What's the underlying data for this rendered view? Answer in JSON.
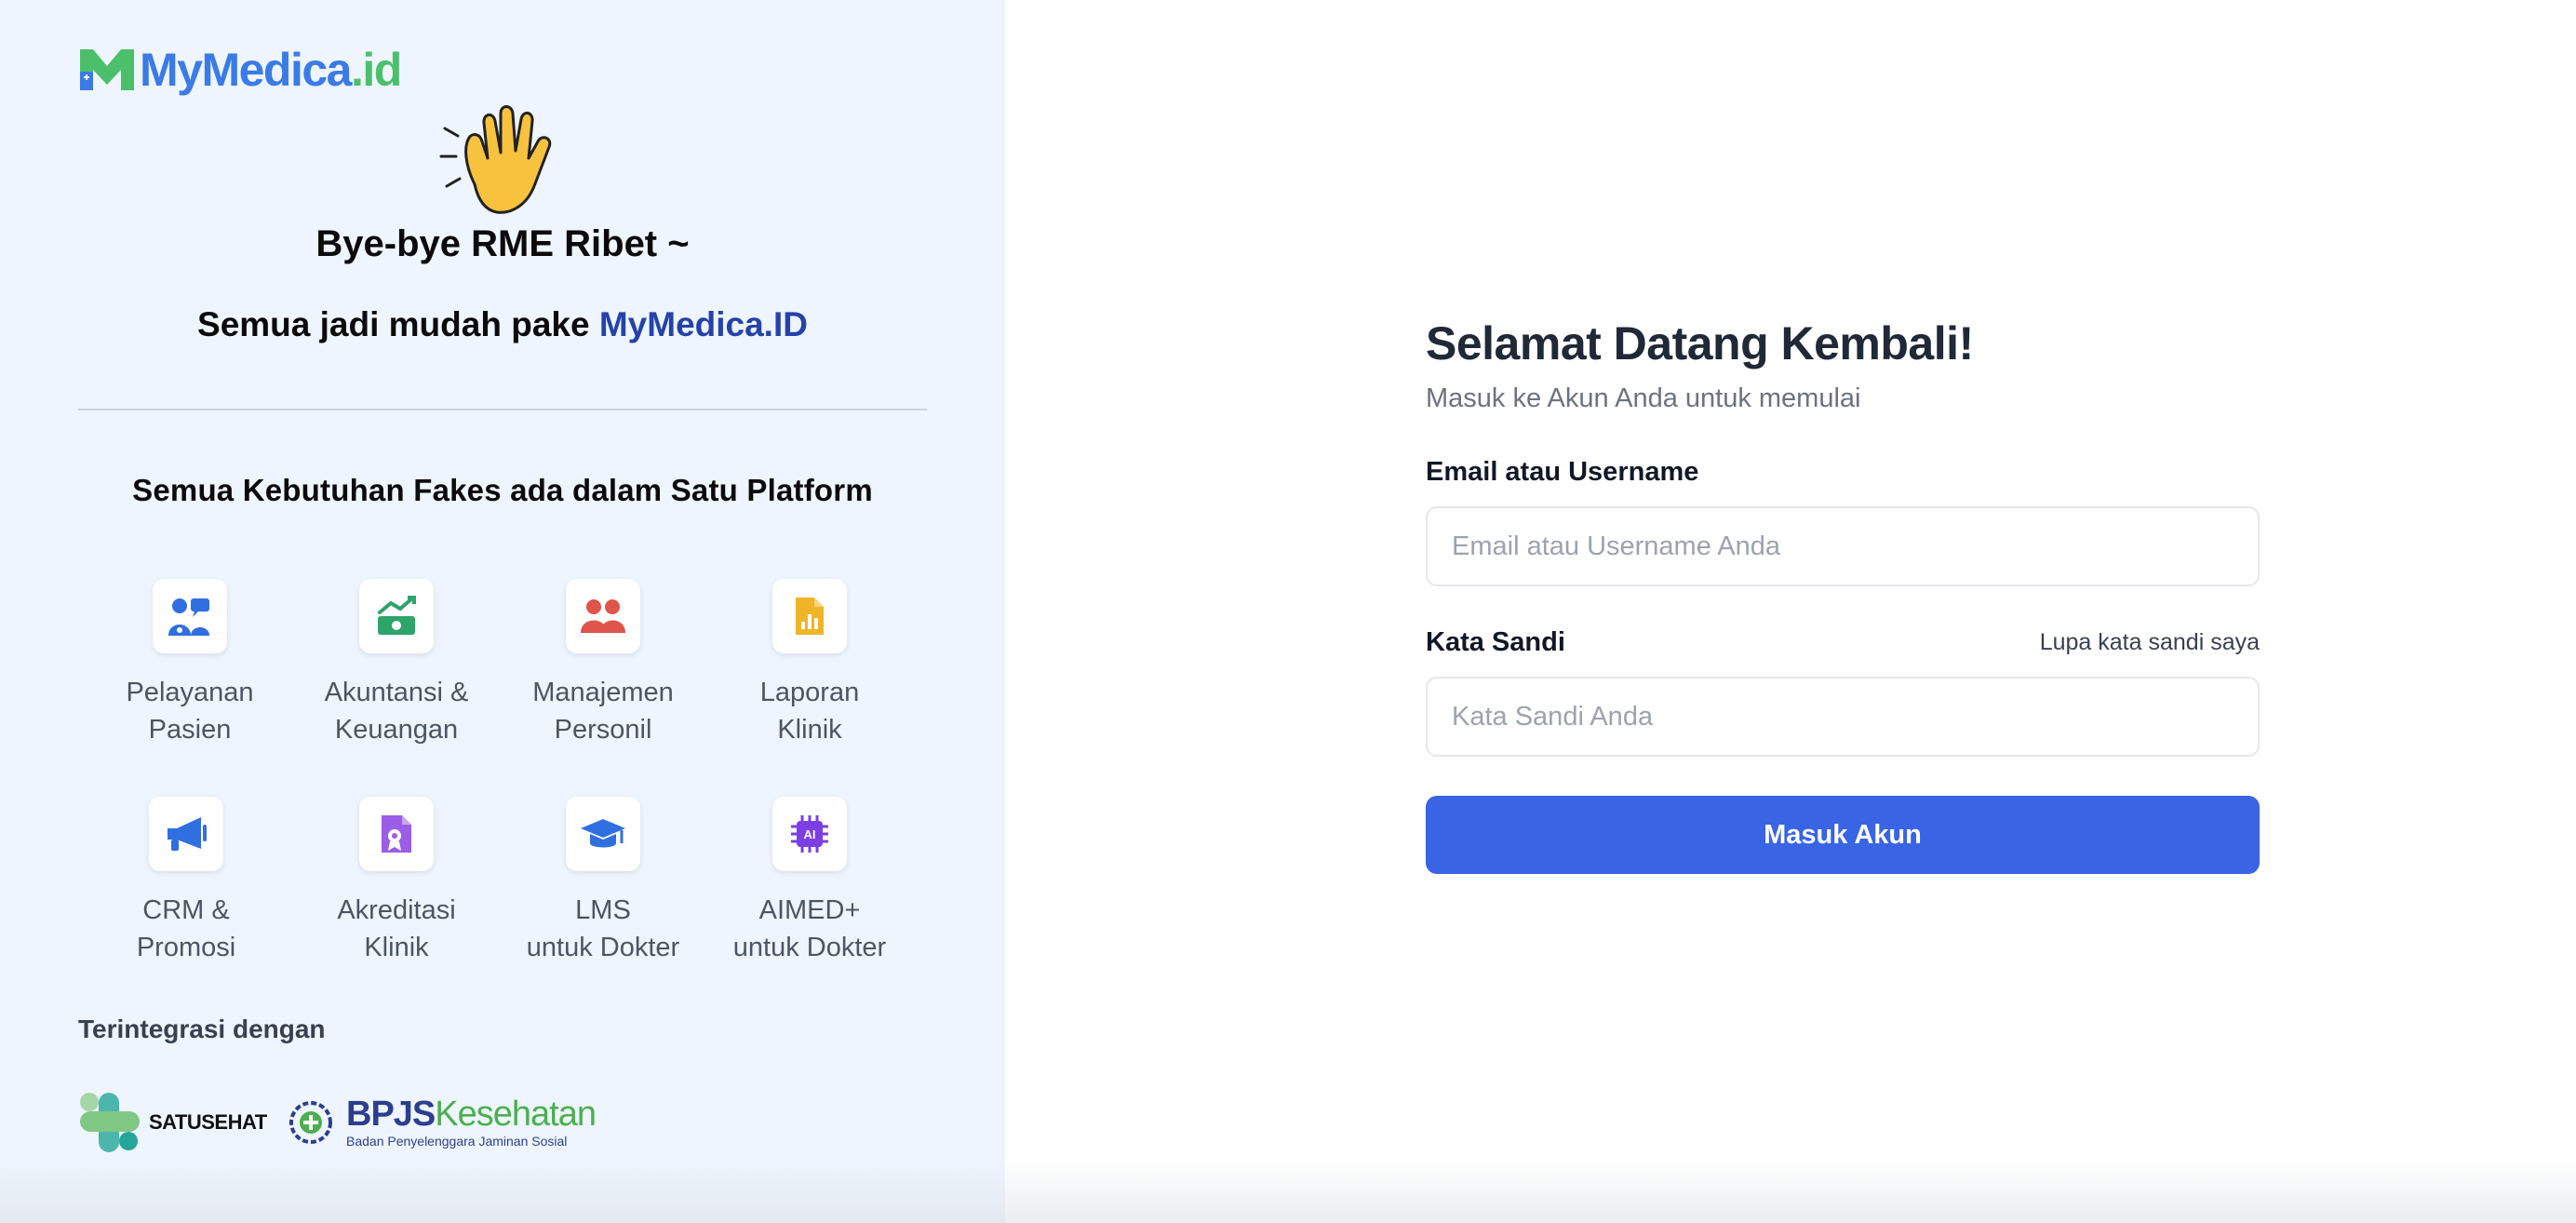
{
  "brand": {
    "logo_text_main": "MyMedica",
    "logo_text_suffix": ".id",
    "primary_color": "#3b7be6",
    "accent_color": "#4cbf6b"
  },
  "hero": {
    "icon": "waving-hand-icon",
    "title": "Bye-bye RME Ribet ~",
    "subtitle_prefix": "Semua jadi mudah pake ",
    "subtitle_brand": "MyMedica.ID"
  },
  "features": {
    "title": "Semua Kebutuhan Fakes ada dalam Satu Platform",
    "items": [
      {
        "icon": "patient-service-icon",
        "line1": "Pelayanan",
        "line2": "Pasien",
        "color": "#2f6fe0"
      },
      {
        "icon": "finance-icon",
        "line1": "Akuntansi &",
        "line2": "Keuangan",
        "color": "#2ea36a"
      },
      {
        "icon": "personnel-icon",
        "line1": "Manajemen",
        "line2": "Personil",
        "color": "#e0544a"
      },
      {
        "icon": "report-icon",
        "line1": "Laporan",
        "line2": "Klinik",
        "color": "#f0b429"
      },
      {
        "icon": "megaphone-icon",
        "line1": "CRM &",
        "line2": "Promosi",
        "color": "#2f6fe0"
      },
      {
        "icon": "accreditation-icon",
        "line1": "Akreditasi",
        "line2": "Klinik",
        "color": "#9b5de5"
      },
      {
        "icon": "graduation-cap-icon",
        "line1": "LMS",
        "line2": "untuk Dokter",
        "color": "#2f6fe0"
      },
      {
        "icon": "ai-chip-icon",
        "line1": "AIMED+",
        "line2": "untuk Dokter",
        "color": "#7b3fe4"
      }
    ]
  },
  "integrations": {
    "title": "Terintegrasi dengan",
    "satusehat": "SATUSEHAT",
    "bpjs_main": "BPJS",
    "bpjs_sub": "Kesehatan",
    "bpjs_tagline": "Badan Penyelenggara Jaminan Sosial"
  },
  "login": {
    "title": "Selamat Datang Kembali!",
    "subtitle": "Masuk ke Akun Anda untuk memulai",
    "email_label": "Email atau Username",
    "email_placeholder": "Email atau Username Anda",
    "email_value": "",
    "password_label": "Kata Sandi",
    "forgot_link": "Lupa kata sandi saya",
    "password_placeholder": "Kata Sandi Anda",
    "password_value": "",
    "submit_label": "Masuk Akun",
    "button_color": "#3964e4"
  }
}
